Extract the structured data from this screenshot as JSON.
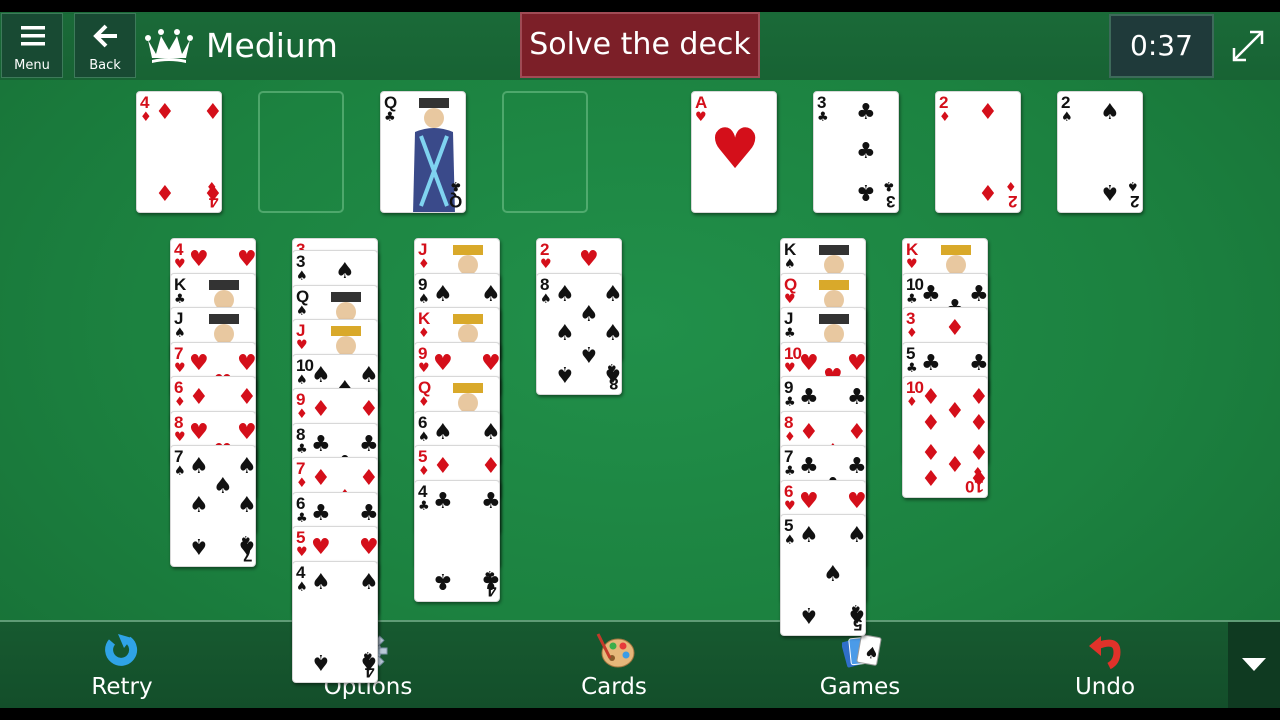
{
  "header": {
    "menu_label": "Menu",
    "back_label": "Back",
    "difficulty_title": "Medium",
    "solve_button": "Solve the deck",
    "timer": "0:37"
  },
  "free_cells": [
    {
      "rank": "4",
      "suit": "♦",
      "color": "red",
      "count": 4
    },
    null,
    {
      "rank": "Q",
      "suit": "♣",
      "color": "black",
      "face": true
    },
    null
  ],
  "foundations": [
    {
      "rank": "A",
      "suit": "♥",
      "color": "red",
      "ace": true
    },
    {
      "rank": "3",
      "suit": "♣",
      "color": "black",
      "count": 3
    },
    {
      "rank": "2",
      "suit": "♦",
      "color": "red",
      "count": 2
    },
    {
      "rank": "2",
      "suit": "♠",
      "color": "black",
      "count": 2
    }
  ],
  "tableau": [
    [
      {
        "rank": "4",
        "suit": "♥",
        "color": "red"
      },
      {
        "rank": "K",
        "suit": "♣",
        "color": "black",
        "face": true
      },
      {
        "rank": "J",
        "suit": "♠",
        "color": "black",
        "face": true
      },
      {
        "rank": "7",
        "suit": "♥",
        "color": "red"
      },
      {
        "rank": "6",
        "suit": "♦",
        "color": "red"
      },
      {
        "rank": "8",
        "suit": "♥",
        "color": "red"
      },
      {
        "rank": "7",
        "suit": "♠",
        "color": "black",
        "count": 7
      }
    ],
    [
      {
        "rank": "3",
        "suit": "♦",
        "color": "red",
        "peek": true
      },
      {
        "rank": "3",
        "suit": "♠",
        "color": "black"
      },
      {
        "rank": "Q",
        "suit": "♠",
        "color": "black",
        "face": true
      },
      {
        "rank": "J",
        "suit": "♥",
        "color": "red",
        "face": true
      },
      {
        "rank": "10",
        "suit": "♠",
        "color": "black"
      },
      {
        "rank": "9",
        "suit": "♦",
        "color": "red"
      },
      {
        "rank": "8",
        "suit": "♣",
        "color": "black"
      },
      {
        "rank": "7",
        "suit": "♦",
        "color": "red"
      },
      {
        "rank": "6",
        "suit": "♣",
        "color": "black"
      },
      {
        "rank": "5",
        "suit": "♥",
        "color": "red"
      },
      {
        "rank": "4",
        "suit": "♠",
        "color": "black",
        "count": 4
      }
    ],
    [
      {
        "rank": "J",
        "suit": "♦",
        "color": "red",
        "face": true
      },
      {
        "rank": "9",
        "suit": "♠",
        "color": "black"
      },
      {
        "rank": "K",
        "suit": "♦",
        "color": "red",
        "face": true
      },
      {
        "rank": "9",
        "suit": "♥",
        "color": "red"
      },
      {
        "rank": "Q",
        "suit": "♦",
        "color": "red",
        "face": true
      },
      {
        "rank": "6",
        "suit": "♠",
        "color": "black"
      },
      {
        "rank": "5",
        "suit": "♦",
        "color": "red"
      },
      {
        "rank": "4",
        "suit": "♣",
        "color": "black",
        "count": 4
      }
    ],
    [
      {
        "rank": "2",
        "suit": "♥",
        "color": "red"
      },
      {
        "rank": "8",
        "suit": "♠",
        "color": "black",
        "count": 8
      }
    ],
    [],
    [
      {
        "rank": "K",
        "suit": "♠",
        "color": "black",
        "face": true
      },
      {
        "rank": "Q",
        "suit": "♥",
        "color": "red",
        "face": true
      },
      {
        "rank": "J",
        "suit": "♣",
        "color": "black",
        "face": true
      },
      {
        "rank": "10",
        "suit": "♥",
        "color": "red"
      },
      {
        "rank": "9",
        "suit": "♣",
        "color": "black"
      },
      {
        "rank": "8",
        "suit": "♦",
        "color": "red"
      },
      {
        "rank": "7",
        "suit": "♣",
        "color": "black"
      },
      {
        "rank": "6",
        "suit": "♥",
        "color": "red"
      },
      {
        "rank": "5",
        "suit": "♠",
        "color": "black",
        "count": 5
      }
    ],
    [
      {
        "rank": "K",
        "suit": "♥",
        "color": "red",
        "face": true
      },
      {
        "rank": "10",
        "suit": "♣",
        "color": "black"
      },
      {
        "rank": "3",
        "suit": "♦",
        "color": "red"
      },
      {
        "rank": "5",
        "suit": "♣",
        "color": "black"
      },
      {
        "rank": "10",
        "suit": "♦",
        "color": "red",
        "count": 10
      }
    ]
  ],
  "toolbar": {
    "retry_label": "Retry",
    "options_label": "Options",
    "cards_label": "Cards",
    "games_label": "Games",
    "undo_label": "Undo"
  },
  "colors": {
    "felt": "#1c8240",
    "header": "#186334",
    "solve_button": "#7c1f28",
    "timer_bg": "#1f3a3a",
    "card_red": "#d40f1a",
    "card_black": "#111111"
  }
}
